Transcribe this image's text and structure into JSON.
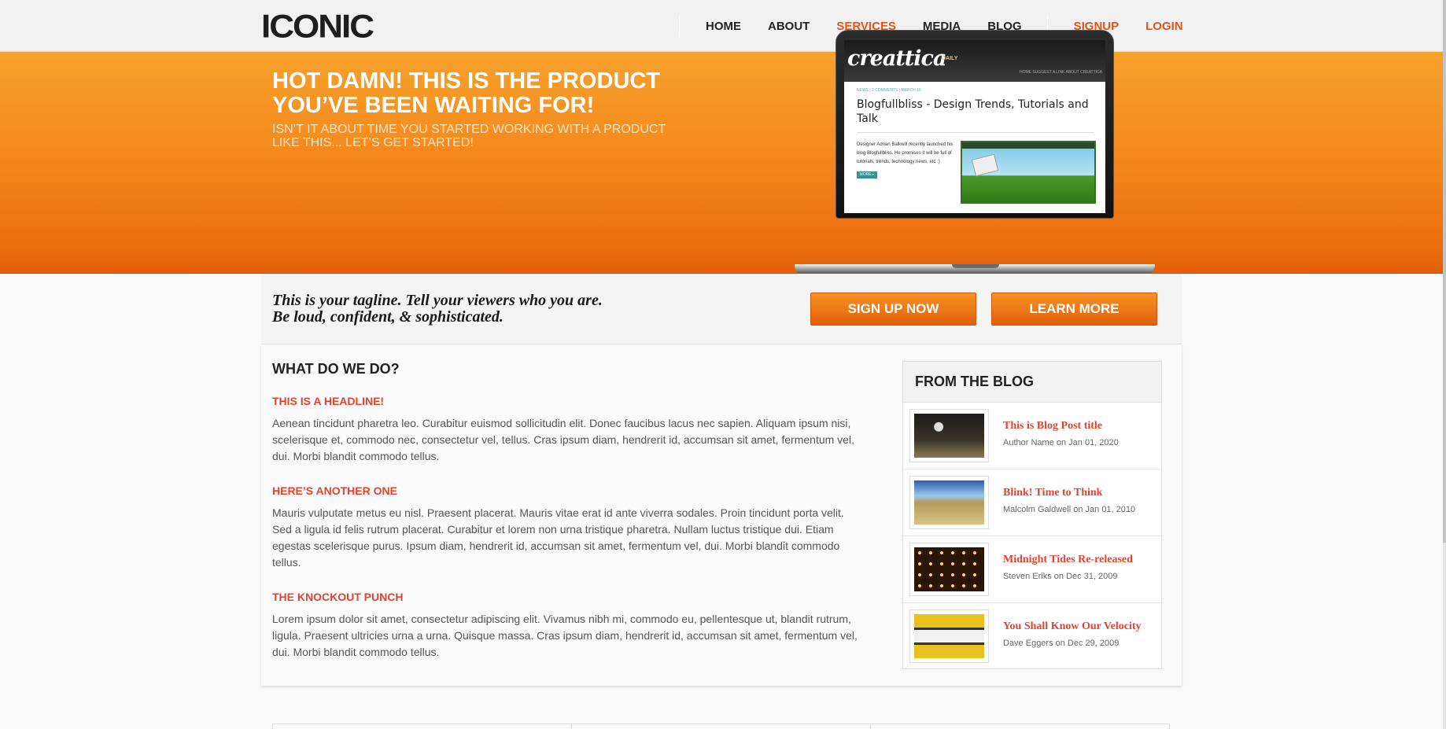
{
  "header": {
    "logo": "ICONIC",
    "nav": [
      {
        "label": "HOME"
      },
      {
        "label": "ABOUT"
      },
      {
        "label": "SERVICES",
        "active": true
      },
      {
        "label": "MEDIA"
      },
      {
        "label": "BLOG"
      }
    ],
    "auth": [
      {
        "label": "SIGNUP"
      },
      {
        "label": "LOGIN"
      }
    ]
  },
  "hero": {
    "title": "HOT DAMN! THIS IS THE PRODUCT YOU’VE BEEN WAITING FOR!",
    "subtitle": "ISN’T IT ABOUT TIME YOU STARTED WORKING WITH A PRODUCT LIKE THIS... LET’S GET STARTED!",
    "screen": {
      "logo": "creattica",
      "logo_tag": "DAILY",
      "nav": "HOME   SUGGEST A LINK   ABOUT CREATTICA",
      "meta": "NEWS  |  2 COMMENTS  |  MARCH 16",
      "title": "Blogfullbliss - Design Trends, Tutorials and Talk",
      "body": "Designer Adrian Balkwill recently launched his blog Blogfullbliss. He promises it will be full of tutorials, trends, technology news, etc :)",
      "more": "MORE ▸"
    }
  },
  "tagline": {
    "line1": "This is your tagline. Tell your viewers who you are.",
    "line2": "Be loud, confident, & sophisticated.",
    "signup_btn": "SIGN UP NOW",
    "learn_btn": "LEARN MORE"
  },
  "main": {
    "title": "WHAT DO WE DO?",
    "items": [
      {
        "headline": "THIS IS A HEADLINE!",
        "text": "Aenean tincidunt pharetra leo. Curabitur euismod sollicitudin elit. Donec faucibus lacus nec sapien. Aliquam ipsum nisi, scelerisque et, commodo nec, consectetur vel, tellus. Cras ipsum diam, hendrerit id, accumsan sit amet, fermentum vel, dui. Morbi blandit commodo tellus."
      },
      {
        "headline": "HERE’S ANOTHER ONE",
        "text": "Mauris vulputate metus eu nisl. Praesent placerat. Mauris vitae erat id ante viverra sodales. Proin tincidunt porta velit. Sed a ligula id felis rutrum placerat. Curabitur et lorem non urna tristique pharetra. Nullam luctus tristique dui. Etiam egestas scelerisque purus. Ipsum diam, hendrerit id, accumsan sit amet, fermentum vel, dui. Morbi blandit commodo tellus."
      },
      {
        "headline": "THE KNOCKOUT PUNCH",
        "text": "Lorem ipsum dolor sit amet, consectetur adipiscing elit. Vivamus nibh mi, commodo eu, pellentesque ut, blandit rutrum, ligula. Praesent ultricies urna a urna. Quisque massa. Cras ipsum diam, hendrerit id, accumsan sit amet, fermentum vel, dui. Morbi blandit commodo tellus."
      }
    ]
  },
  "blog": {
    "title": "FROM THE BLOG",
    "posts": [
      {
        "title": "This is Blog Post title",
        "meta": "Author Name on Jan 01, 2020"
      },
      {
        "title": "Blink! Time to Think",
        "meta": "Malcolm Galdwell on Jan 01, 2010"
      },
      {
        "title": "Midnight Tides Re-released",
        "meta": "Steven Eriks on Dec 31, 2009"
      },
      {
        "title": "You Shall Know Our Velocity",
        "meta": "Dave Eggers on Dec 29, 2009"
      }
    ]
  },
  "colors": {
    "accent": "#e0551a",
    "headline_red": "#e2432f",
    "hero_orange": "#f48a1e"
  }
}
